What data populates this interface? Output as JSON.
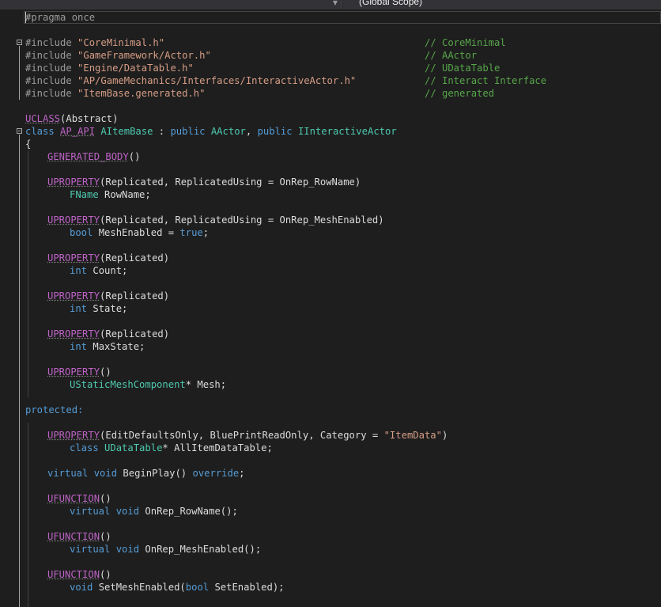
{
  "toolbar": {
    "scope_label": "(Global Scope)",
    "dropdown_arrow": "▼"
  },
  "code": {
    "pragma": "#pragma once",
    "includes": [
      {
        "directive": "#include ",
        "path": "\"CoreMinimal.h\"",
        "comment": "// CoreMinimal"
      },
      {
        "directive": "#include ",
        "path": "\"GameFramework/Actor.h\"",
        "comment": "// AActor"
      },
      {
        "directive": "#include ",
        "path": "\"Engine/DataTable.h\"",
        "comment": "// UDataTable"
      },
      {
        "directive": "#include ",
        "path": "\"AP/GameMechanics/Interfaces/InteractiveActor.h\"",
        "comment": "// Interact Interface"
      },
      {
        "directive": "#include ",
        "path": "\"ItemBase.generated.h\"",
        "comment": "// generated"
      }
    ],
    "uclass_macro": "UCLASS",
    "uclass_args": "(Abstract)",
    "class_kw": "class",
    "api_macro": "AP_API",
    "class_name": "AItemBase",
    "colon": " : ",
    "public_kw": "public",
    "base1": "AActor",
    "comma": ", ",
    "base2": "IInteractiveActor",
    "open_brace": "{",
    "generated_body": "GENERATED_BODY",
    "parens": "()",
    "uproperty": "UPROPERTY",
    "ufunction": "UFUNCTION",
    "prop_rowname_args": "(Replicated, ReplicatedUsing = OnRep_RowName)",
    "fname_type": "FName",
    "rowname_decl": " RowName;",
    "prop_mesh_args": "(Replicated, ReplicatedUsing = OnRep_MeshEnabled)",
    "bool_kw": "bool",
    "meshenabled_decl": " MeshEnabled = ",
    "true_kw": "true",
    "semicolon": ";",
    "replicated_args": "(Replicated)",
    "int_kw": "int",
    "count_decl": " Count;",
    "state_decl": " State;",
    "maxstate_decl": " MaxState;",
    "empty_args": "()",
    "ustatic_type": "UStaticMeshComponent",
    "mesh_decl": "* Mesh;",
    "protected_kw": "protected:",
    "edit_args_pre": "(EditDefaultsOnly, BluePrintReadOnly, Category = ",
    "category_str": "\"ItemData\"",
    "edit_args_post": ")",
    "udatatable_type": "UDataTable",
    "alltable_decl": "* AllItemDataTable;",
    "virtual_kw": "virtual",
    "void_kw": "void",
    "beginplay": " BeginPlay() ",
    "override_kw": "override",
    "onrep_rowname": " OnRep_RowName();",
    "onrep_meshenabled": " OnRep_MeshEnabled();",
    "setmesh_pre": " SetMeshEnabled(",
    "setmesh_param": " SetEnabled);"
  }
}
